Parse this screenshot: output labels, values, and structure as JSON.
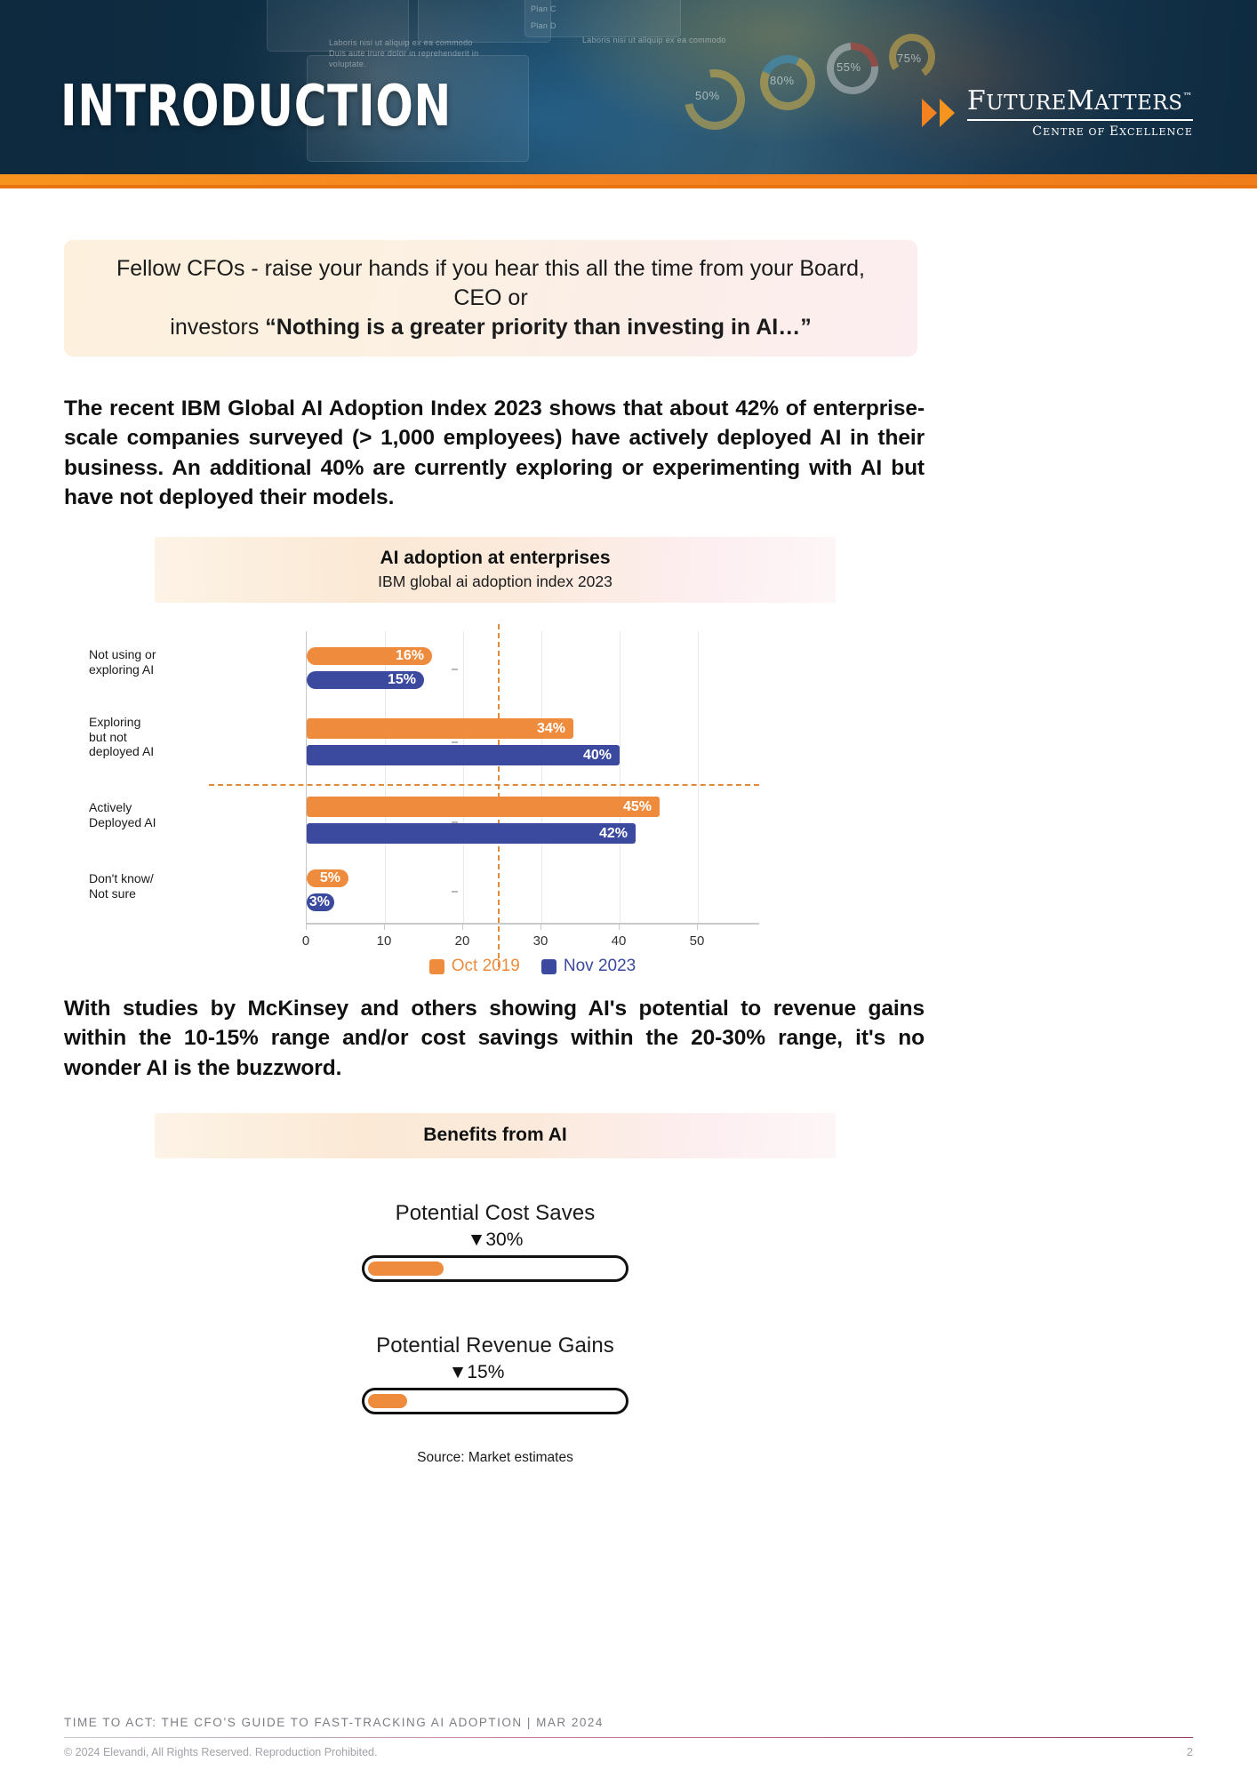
{
  "banner": {
    "title": "INTRODUCTION",
    "logo": {
      "word1": "F",
      "word1rest": "UTURE",
      "word2": "M",
      "word2rest": "ATTERS",
      "tm": "™",
      "sub_c": "C",
      "sub_rest1": "ENTRE OF ",
      "sub_e": "E",
      "sub_rest2": "XCELLENCE"
    },
    "photo_labels": {
      "plan_c": "Plan C",
      "plan_d": "Plan D",
      "caption_left": "Laboris nisi ut aliquip ex ea commodo Duis aute irure dolor in reprehenderit in voluptate.",
      "caption_right": "Laboris nisi ut aliquip ex ea commodo",
      "donut_50": "50%",
      "donut_80": "80%",
      "donut_55": "55%",
      "donut_75": "75%"
    }
  },
  "quote": {
    "line1": "Fellow CFOs - raise your hands if you hear this all the time from your Board, CEO or",
    "line2_plain": "investors ",
    "line2_bold": "“Nothing is a greater priority than investing in AI…”"
  },
  "paragraph1": "The recent IBM Global AI Adoption Index 2023 shows that about 42% of enterprise-scale companies surveyed (> 1,000 employees) have actively deployed AI in their business. An additional 40% are currently exploring or experimenting with AI but have not deployed their models.",
  "paragraph2": "With studies by McKinsey and others showing AI's potential to revenue gains within the 10-15% range and/or cost savings within the 20-30% range, it's no wonder AI is the buzzword.",
  "chart_data": {
    "type": "bar",
    "orientation": "horizontal",
    "title": "AI adoption at enterprises",
    "subtitle": "IBM global ai adoption index 2023",
    "xlabel": "",
    "ylabel": "",
    "xlim": [
      0,
      58
    ],
    "xticks": [
      0,
      10,
      20,
      30,
      40,
      50
    ],
    "xtick_labels": [
      "0",
      "10",
      "20",
      "30",
      "40",
      "50"
    ],
    "grid": true,
    "legend_position": "bottom",
    "annotations": {
      "vertical_reference_line": 24.5,
      "horizontal_reference_line": "between Exploring and Actively Deployed"
    },
    "categories": [
      "Not using or exploring AI",
      "Exploring but not deployed AI",
      "Actively Deployed AI",
      "Don't know/ Not sure"
    ],
    "category_lines": [
      [
        "Not using or",
        "exploring AI"
      ],
      [
        "Exploring",
        "but not",
        "deployed AI"
      ],
      [
        "Actively",
        "Deployed AI"
      ],
      [
        "Don't know/",
        "Not sure"
      ]
    ],
    "series": [
      {
        "name": "Oct 2019",
        "color": "#ee8b3d",
        "values": [
          16,
          34,
          45,
          5
        ],
        "labels": [
          "16%",
          "34%",
          "45%",
          "5%"
        ]
      },
      {
        "name": "Nov 2023",
        "color": "#3b4a9e",
        "values": [
          15,
          40,
          42,
          3
        ],
        "labels": [
          "15%",
          "40%",
          "42%",
          "3%"
        ]
      }
    ]
  },
  "benefits": {
    "title": "Benefits from AI",
    "gauges": [
      {
        "label": "Potential Cost Saves",
        "marker": "▼30%",
        "value": 30,
        "max": 100,
        "fill_pct": 30,
        "color": "#ee8b3d"
      },
      {
        "label": "Potential Revenue Gains",
        "marker": "▼15%",
        "value": 15,
        "max": 100,
        "fill_pct": 15,
        "color": "#ee8b3d"
      }
    ],
    "source": "Source: Market estimates"
  },
  "footer": {
    "title": "TIME TO ACT: THE CFO’S GUIDE TO FAST-TRACKING AI ADOPTION  |  MAR 2024",
    "copyright": "© 2024 Elevandi, All Rights Reserved. Reproduction Prohibited.",
    "page": "2"
  },
  "colors": {
    "banner_navy": "#113049",
    "accent_orange": "#f58220",
    "series_orange": "#ee8b3d",
    "series_blue": "#3b4a9e"
  }
}
